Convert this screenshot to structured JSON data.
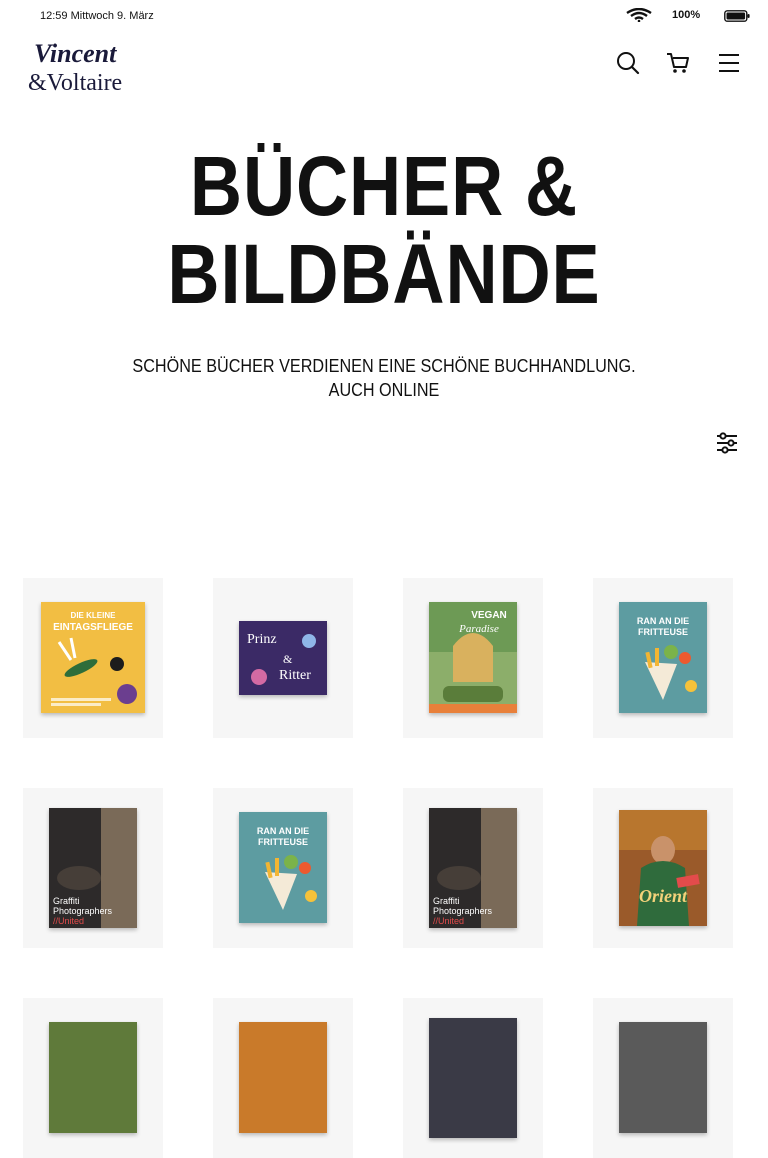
{
  "status": {
    "time": "12:59",
    "date": "Mittwoch 9. März",
    "battery": "100%"
  },
  "header": {
    "logo_text": "Vincent & Voltaire",
    "icons": [
      "search-icon",
      "cart-icon",
      "menu-icon"
    ]
  },
  "hero": {
    "title_line1": "BÜCHER &",
    "title_line2": "BILDBÄNDE",
    "subtitle_line1": "SCHÖNE BÜCHER VERDIENEN EINE SCHÖNE BUCHHANDLUNG.",
    "subtitle_line2": "AUCH ONLINE"
  },
  "filter": {
    "icon": "filter-sliders-icon"
  },
  "products": [
    {
      "name": "Die kleine Eintagsfliege",
      "cover_title_l1": "DIE KLEINE",
      "cover_title_l2": "EINTAGSFLIEGE",
      "color": "#f2be43"
    },
    {
      "name": "Prinz & Ritter",
      "cover_title_l1": "Prinz",
      "cover_title_l2": "Ritter",
      "color": "#3b2a66"
    },
    {
      "name": "Vegan Paradise",
      "cover_title_l1": "VEGAN",
      "cover_title_l2": "Paradise",
      "color": "#8cae6a"
    },
    {
      "name": "Ran an die Fritteuse",
      "cover_title_l1": "RAN AN DIE",
      "cover_title_l2": "FRITTEUSE",
      "color": "#5d9ca1"
    },
    {
      "name": "Graffiti Photographers United",
      "cover_title_l1": "Graffiti",
      "cover_title_l2": "Photographers",
      "cover_title_l3": "//United",
      "color": "#2d2a2a"
    },
    {
      "name": "Ran an die Fritteuse",
      "cover_title_l1": "RAN AN DIE",
      "cover_title_l2": "FRITTEUSE",
      "color": "#5d9ca1"
    },
    {
      "name": "Graffiti Photographers United",
      "cover_title_l1": "Graffiti",
      "cover_title_l2": "Photographers",
      "cover_title_l3": "//United",
      "color": "#2d2a2a"
    },
    {
      "name": "Orient",
      "cover_title_l1": "Orient",
      "cover_title_l2": "",
      "color": "#9a5a2a"
    }
  ]
}
